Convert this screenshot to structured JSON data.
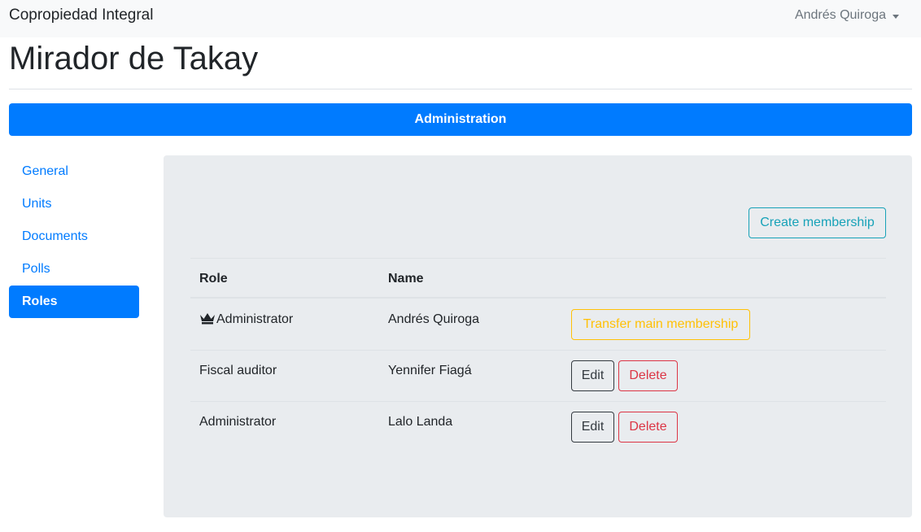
{
  "navbar": {
    "brand": "Copropiedad Integral",
    "user_name": "Andrés Quiroga"
  },
  "page": {
    "title": "Mirador de Takay"
  },
  "section_bar": {
    "label": "Administration"
  },
  "sidebar": {
    "items": [
      {
        "label": "General",
        "active": false
      },
      {
        "label": "Units",
        "active": false
      },
      {
        "label": "Documents",
        "active": false
      },
      {
        "label": "Polls",
        "active": false
      },
      {
        "label": "Roles",
        "active": true
      }
    ]
  },
  "roles": {
    "create_label": "Create membership",
    "columns": [
      "Role",
      "Name"
    ],
    "rows": [
      {
        "role": "Administrator",
        "name": "Andrés Quiroga",
        "main": true,
        "action_label": "Transfer main membership"
      },
      {
        "role": "Fiscal auditor",
        "name": "Yennifer Fiagá",
        "main": false,
        "edit_label": "Edit",
        "delete_label": "Delete"
      },
      {
        "role": "Administrator",
        "name": "Lalo Landa",
        "main": false,
        "edit_label": "Edit",
        "delete_label": "Delete"
      }
    ]
  },
  "colors": {
    "primary": "#007bff",
    "info": "#17a2b8",
    "warning": "#ffc107",
    "danger": "#dc3545",
    "dark": "#343a40",
    "panel": "#e9ecef",
    "navbar": "#f8f9fa"
  },
  "icons": {
    "main_role": "crown-icon",
    "user_menu": "chevron-down-icon"
  }
}
